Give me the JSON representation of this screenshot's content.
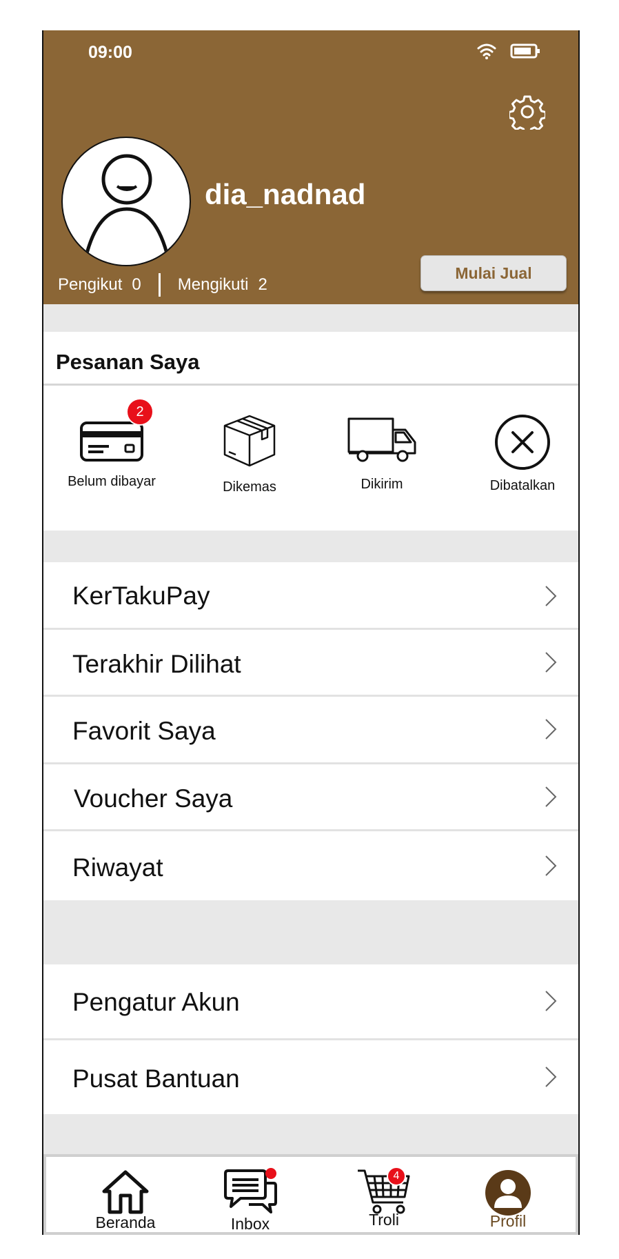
{
  "status_bar": {
    "time": "09:00"
  },
  "profile": {
    "username": "dia_nadnad",
    "followers_label": "Pengikut",
    "followers_count": "0",
    "following_label": "Mengikuti",
    "following_count": "2",
    "sell_button": "Mulai Jual"
  },
  "orders": {
    "title": "Pesanan Saya",
    "items": [
      {
        "label": "Belum dibayar",
        "icon": "credit-card-icon",
        "badge": "2"
      },
      {
        "label": "Dikemas",
        "icon": "package-box-icon"
      },
      {
        "label": "Dikirim",
        "icon": "delivery-truck-icon"
      },
      {
        "label": "Dibatalkan",
        "icon": "cancel-circle-icon"
      }
    ]
  },
  "menu_group_1": [
    {
      "label": "KerTakuPay"
    },
    {
      "label": "Terakhir Dilihat"
    },
    {
      "label": "Favorit Saya"
    },
    {
      "label": "Voucher Saya"
    },
    {
      "label": "Riwayat"
    }
  ],
  "menu_group_2": [
    {
      "label": "Pengatur Akun"
    },
    {
      "label": "Pusat Bantuan"
    }
  ],
  "bottom_nav": [
    {
      "label": "Beranda",
      "icon": "home-icon"
    },
    {
      "label": "Inbox",
      "icon": "chat-icon",
      "dot": true
    },
    {
      "label": "Troli",
      "icon": "cart-icon",
      "badge": "4"
    },
    {
      "label": "Profil",
      "icon": "profile-icon",
      "active": true
    }
  ],
  "colors": {
    "brand": "#8b6636",
    "badge": "#e8101a",
    "divider": "#e8e8e8"
  }
}
